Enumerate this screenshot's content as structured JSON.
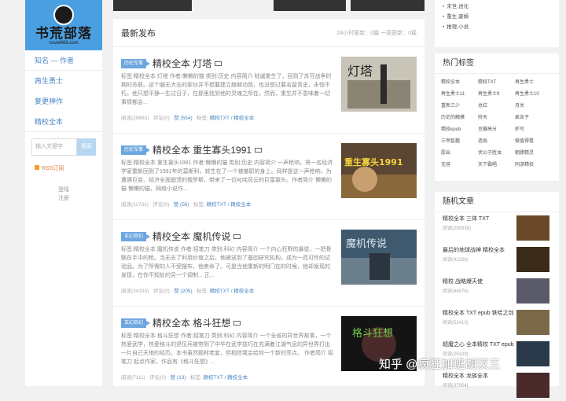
{
  "sidebar": {
    "logo_name": "书荒部落",
    "logo_sub": "novel666.com",
    "nav": [
      "知名 — 作者",
      "再生勇士",
      "复更神作",
      "精校全本"
    ],
    "search_placeholder": "输入关键字",
    "search_button": "搜索",
    "rss": "RSS订阅",
    "login": "登陆",
    "register": "注册"
  },
  "main": {
    "heading": "最新发布",
    "stats": "24小时更新：0篇   一周更新：0篇",
    "posts": [
      {
        "category": "历史军事",
        "title": "精校全本 灯塔",
        "desc": "标签:精校全本 灯塔 作者:懒懒的猫 类别:历史 内容简介 陆诚重生了，回到了苏芬战争时期的苏联。这个脑无大志的家伙并不想要建立赫赫功勋，也没想过要名留青史，永恒不朽。他只想平静一生过日子，在那里找到他的灵魂之所在，然而，重生并不意味着一切事情都会...",
        "views": "阅读(29663)",
        "comments": "评论(0)",
        "likes": "赞 (554)",
        "tags_label": "标签:",
        "tags": "精校TXT / 精校全本",
        "thumb_text": "灯塔"
      },
      {
        "category": "历史军事",
        "title": "精校全本 重生寡头1991",
        "desc": "标签:精校全本 重生寡头1991 作者:懒懒的猫 类别:历史 内容简介 一声枪响，将一名经济学家重新回到了1991年的莫斯科，转生在了一个被撤职的身上。同样是这一声枪响，为遭遇巨变、经济全面崩溃的俄罗斯，带来了一位叱咤风云的巨富寡头。作者简介 懒懒的猫 懒懒的猫，网络小说作...",
        "views": "阅读(11731)",
        "comments": "评论(0)",
        "likes": "赞 (56)",
        "tags_label": "标签:",
        "tags": "精校TXT / 精校全本",
        "thumb_text": "重生寡头1991"
      },
      {
        "category": "玄幻奇幻",
        "title": "精校全本 魔机传说",
        "desc": "标签:精校全本 魔机传说 作者:招笔刀 类别:科幻 内容简介 一个内心狂野的暴徒，一把骨骸在手中的枪。当无去了利用价值之后，他被送到了基因研究机构，成为一具可怜的试验品。为了所需的人不受摆布，他卖命了。可是当他重新的明门在的时候，他却发现的发现，在你不知处的另一个调制... 正...",
        "views": "阅读(34193)",
        "comments": "评论(0)",
        "likes": "赞 (205)",
        "tags_label": "标签:",
        "tags": "精校TXT / 精校全本",
        "thumb_text": "魔机传说"
      },
      {
        "category": "玄幻奇幻",
        "title": "精校全本 格斗狂想",
        "desc": "标签:精校全本 格斗狂想 作者:招笔刀 类别:科幻 内容简介 一个全省的异世界故事，一个热爱武学，热爱格斗的退伍兵被带到了中华在武学技巧在充满着江湖气息的异世界打出一片自己天地的经历。本书虽然题材老套，但相信我会给你一个新的亮点。 作者简介 招笔刀 起点作家，作品有《格斗狂想》...",
        "views": "阅读(7111)",
        "comments": "评论(0)",
        "likes": "赞 (13)",
        "tags_label": "标签:",
        "tags": "精校TXT / 精校全本",
        "thumb_text": "格斗狂想"
      }
    ]
  },
  "right_top": [
    "末世,进化",
    "重生,豪婿",
    "推理,小说"
  ],
  "hot_tags": {
    "heading": "热门标签",
    "tags": [
      "精校全本",
      "精校TXT",
      "再生勇士",
      "再生勇士11",
      "再生勇士9",
      "再生勇士10",
      "重新三少",
      "总红",
      "月关",
      "历史的触摸",
      "府天",
      "疯苦子",
      "精校epub",
      "豆瓣高分",
      "虾写",
      "三帝智趣",
      "造局",
      "做值得看",
      "愿出",
      "伏公子胜浊",
      "朝腊精灵",
      "无容",
      "天下霸唱",
      "同游精校"
    ]
  },
  "random": {
    "heading": "随机文章",
    "items": [
      {
        "title": "精校全本 三体 TXT",
        "views": "阅读(295936)"
      },
      {
        "title": "最后的地球战神 精校全本",
        "views": "阅读(42268)"
      },
      {
        "title": "精校 战略爆天使",
        "views": "阅读(44976)"
      },
      {
        "title": "精校全本 TXT epub 铁哈之剑",
        "views": "阅读(52413)"
      },
      {
        "title": "超魔之心 全本精校 TXT epub",
        "views": "阅读(26139)"
      },
      {
        "title": "精校全本 龙族全本",
        "views": "阅读(37954)"
      }
    ]
  },
  "watermark": "知乎 @疯狂加班胡汉三"
}
